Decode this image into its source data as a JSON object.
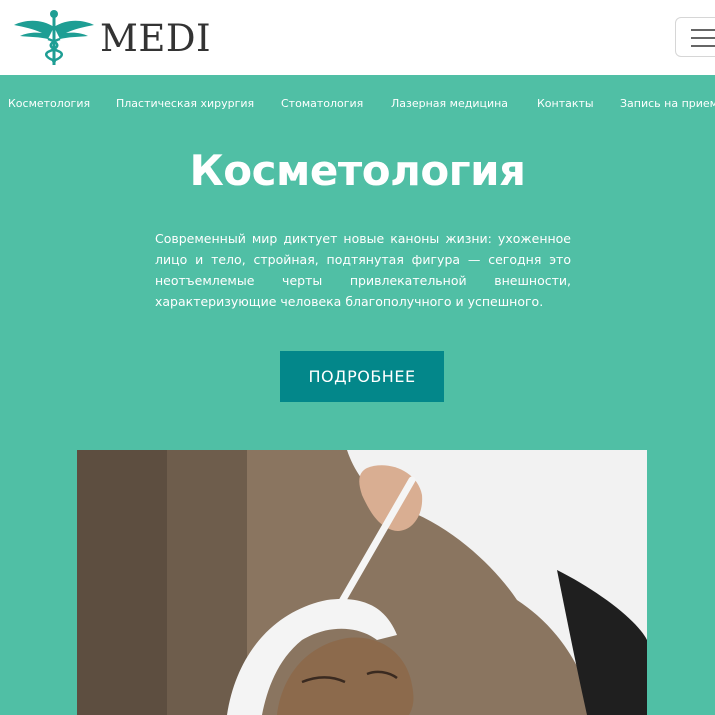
{
  "header": {
    "logo_text": "MEDI",
    "logo_icon": "caduceus-icon",
    "menu_icon": "hamburger-icon"
  },
  "nav": {
    "items": [
      "Косметология",
      "Пластическая хирургия",
      "Стоматология",
      "Лазерная медицина",
      "Контакты",
      "Запись на прием"
    ]
  },
  "hero": {
    "title": "Косметология",
    "description": "Современный мир диктует новые каноны жизни: ухоженное лицо и тело, стройная, подтянутая фигура — сегодня это неотъемлемые черты привлекательной внешности, характеризующие человека благополучного и успешного.",
    "button_label": "ПОДРОБНЕЕ"
  },
  "colors": {
    "background": "#50bfa5",
    "header": "#ffffff",
    "button": "#03878a",
    "logo_teal": "#1e9e94"
  }
}
